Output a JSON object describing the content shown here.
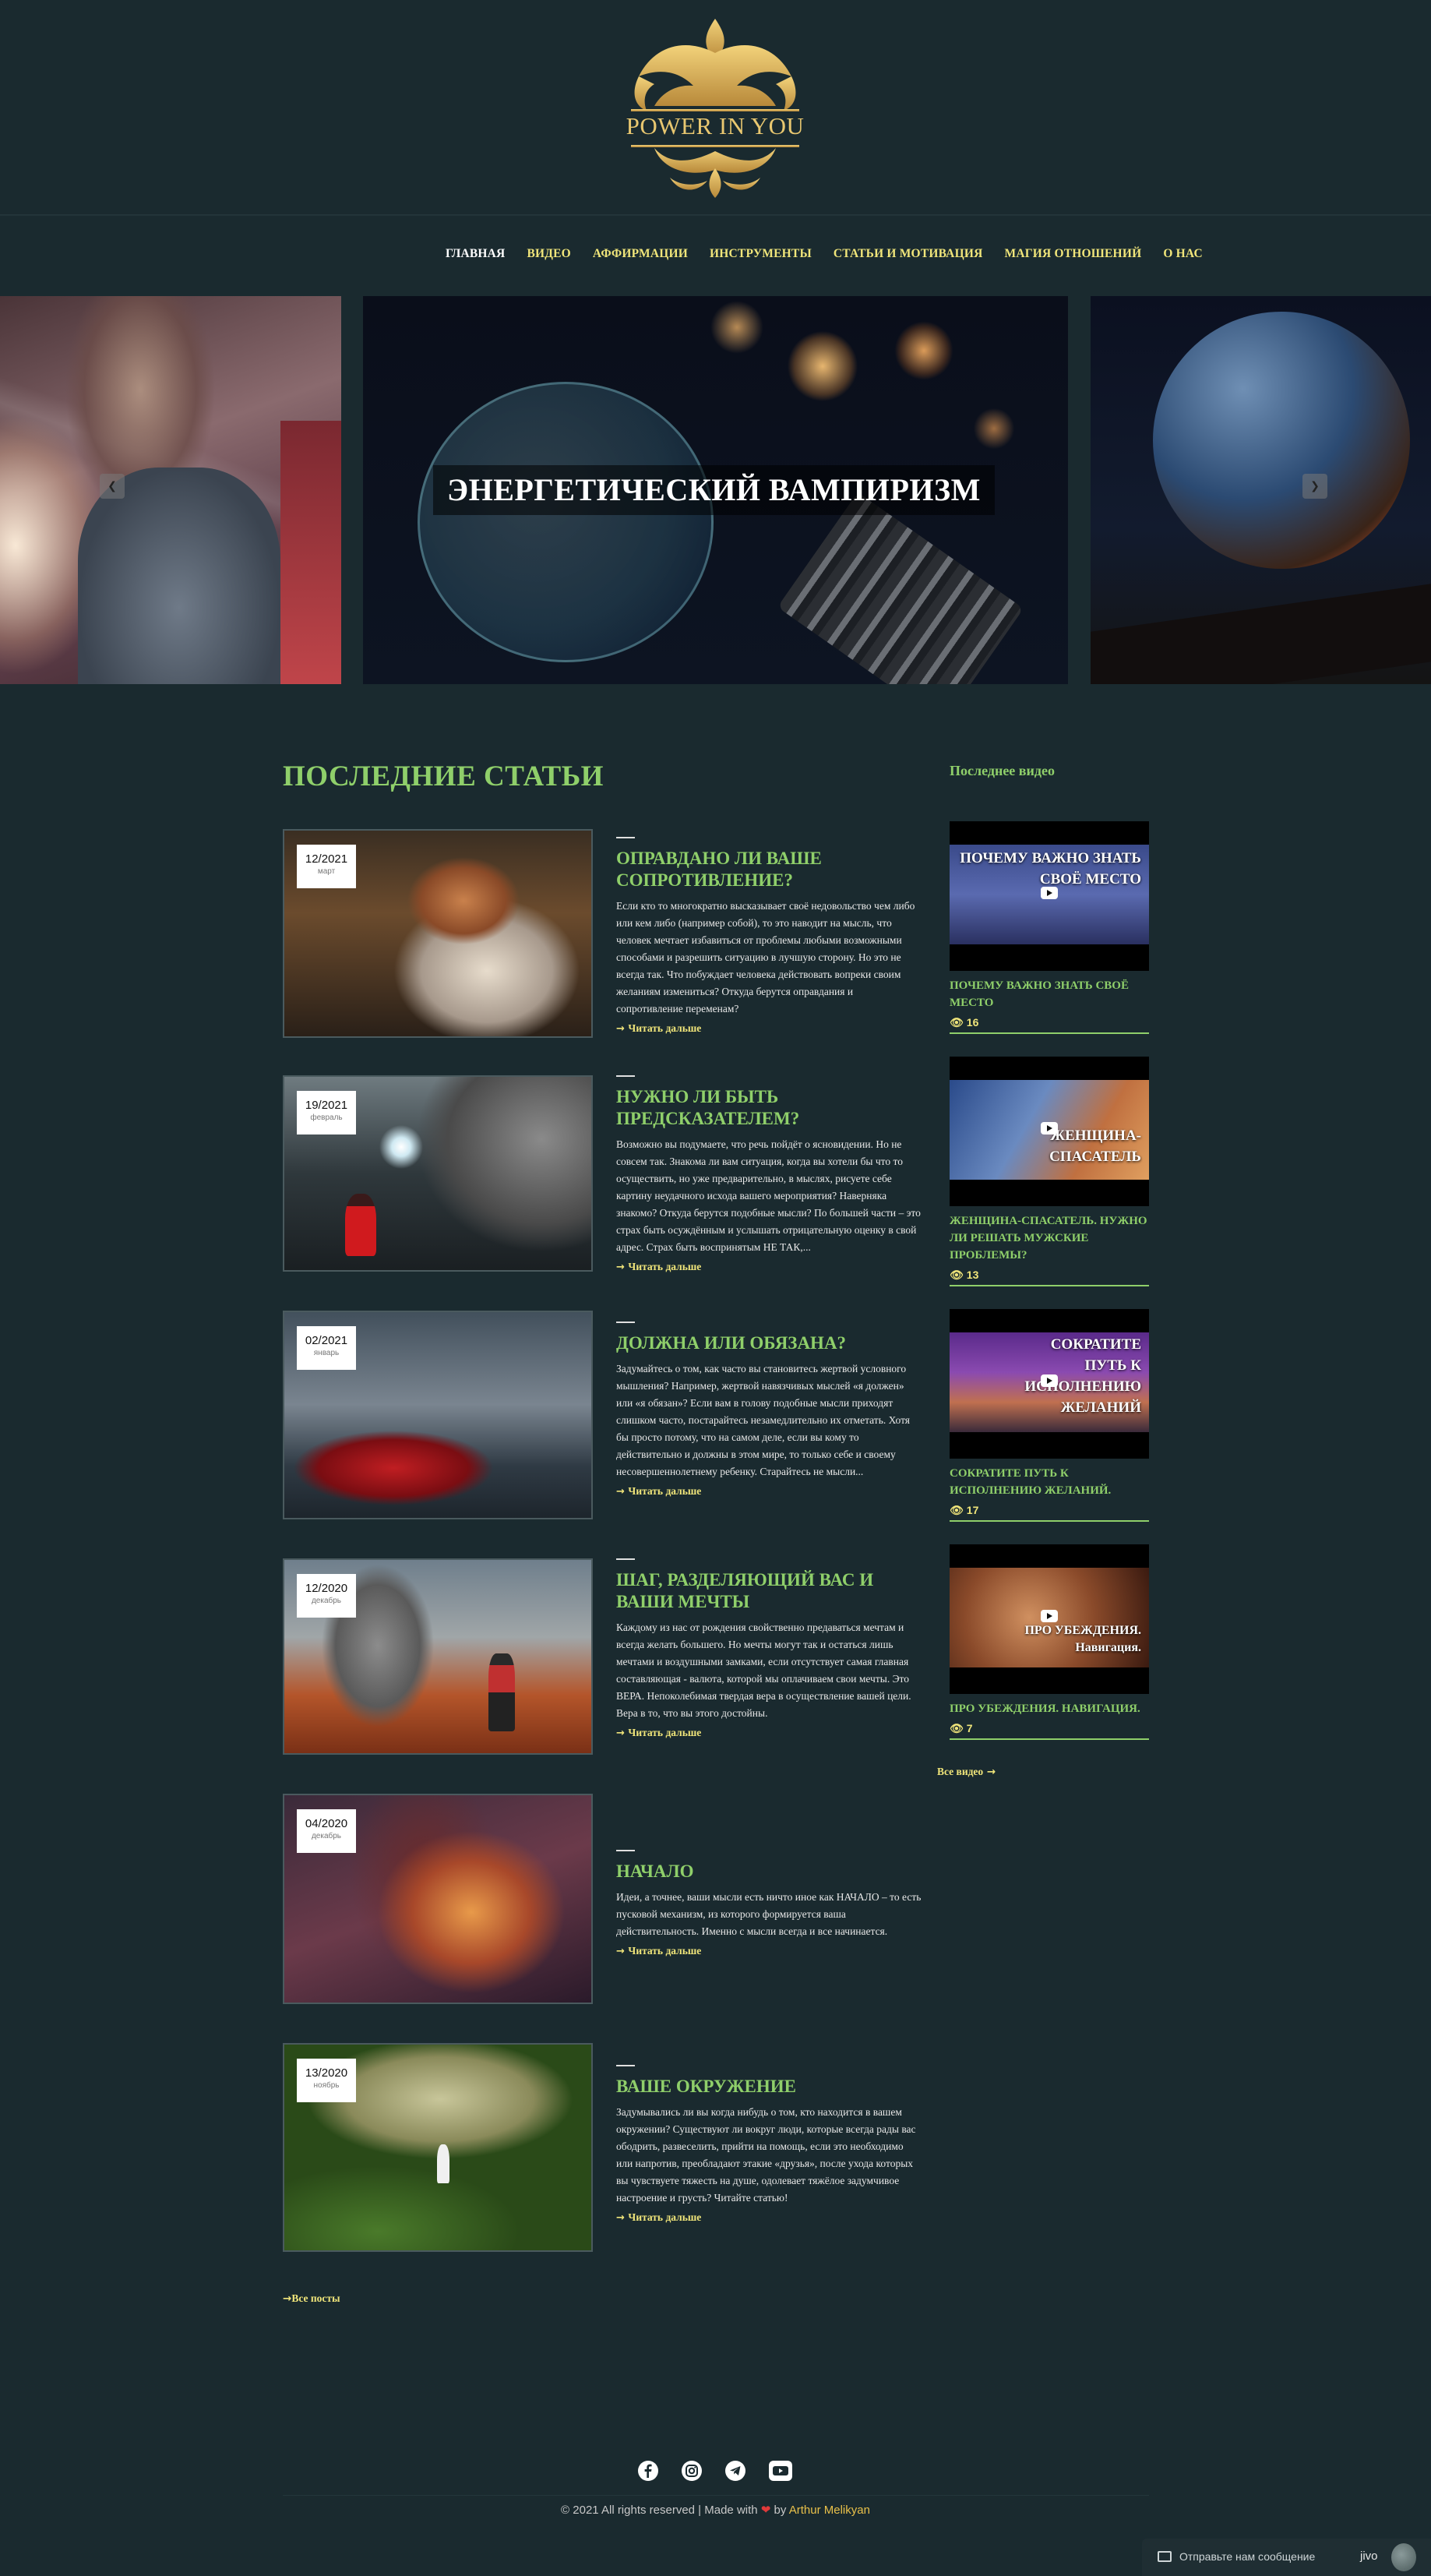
{
  "logo": {
    "text": "POWER IN YOU"
  },
  "nav": {
    "items": [
      "Главная",
      "Видео",
      "Аффирмации",
      "Инструменты",
      "Статьи и мотивация",
      "Магия отношений",
      "О нас"
    ]
  },
  "slider": {
    "caption": "Энергетический вампиризм",
    "prev_icon": "chevron-left-icon",
    "next_icon": "chevron-right-icon"
  },
  "articles_section": {
    "title": "ПОСЛЕДНИЕ СТАТЬИ",
    "read_more": "Читать дальше",
    "all_posts": "Все посты",
    "items": [
      {
        "date": "12/2021",
        "month": "март",
        "title": "Оправдано ли ваше сопротивление?",
        "text": "Если кто то многократно высказывает своё недовольство чем либо или кем либо (например собой), то это наводит на мысль, что человек мечтает избавиться от проблемы любыми возможными способами и разрешить ситуацию в лучшую сторону. Но это не всегда так. Что побуждает человека действовать вопреки своим желаниям измениться? Откуда берутся оправдания и сопротивление переменам?"
      },
      {
        "date": "19/2021",
        "month": "февраль",
        "title": "Нужно ли быть предсказателем?",
        "text": "Возможно вы подумаете, что речь пойдёт о ясновидении. Но не совсем так. Знакома ли вам ситуация, когда вы хотели бы что то осуществить, но уже предварительно, в мыслях, рисуете себе картину неудачного исхода вашего мероприятия? Наверняка знакомо? Откуда берутся подобные мысли? По большей части – это страх быть осуждённым и услышать отрицательную оценку в свой адрес. Страх быть воспринятым НЕ ТАК,..."
      },
      {
        "date": "02/2021",
        "month": "январь",
        "title": "Должна или обязана?",
        "text": "Задумайтесь о том, как часто вы становитесь жертвой условного мышления? Например, жертвой навязчивых мыслей «я должен» или «я обязан»? Если вам в голову подобные мысли приходят слишком часто, постарайтесь незамедлительно их отметать. Хотя бы просто потому, что на самом деле, если вы кому то действительно и должны в этом мире, то только себе и своему несовершеннолетнему ребенку. Старайтесь не мысли..."
      },
      {
        "date": "12/2020",
        "month": "декабрь",
        "title": "Шаг, разделяющий вас и ваши мечты",
        "text": "Каждому из нас от рождения свойственно предаваться мечтам и всегда желать большего. Но мечты могут так и остаться лишь мечтами и воздушными замками, если отсутствует самая главная составляющая - валюта, которой мы оплачиваем свои мечты. Это ВЕРА. Непоколебимая твердая вера в осуществление вашей цели. Вера в то, что вы этого достойны."
      },
      {
        "date": "04/2020",
        "month": "декабрь",
        "title": "Начало",
        "text": "Идеи, а точнее, ваши мысли есть ничто иное как НАЧАЛО – то есть пусковой механизм, из которого формируется ваша действительность. Именно с мысли всегда и все начинается."
      },
      {
        "date": "13/2020",
        "month": "ноябрь",
        "title": "Ваше окружение",
        "text": "Задумывались ли вы когда нибудь о том, кто находится в вашем окружении? Существуют ли вокруг люди, которые всегда рады вас ободрить, развеселить, прийти на помощь, если это необходимо или напротив, преобладают этакие «друзья», после ухода которых вы чувствуете тяжесть на душе, одолевает тяжёлое задумчивое настроение и грусть? Читайте статью!"
      }
    ]
  },
  "videos_section": {
    "title": "Последнее видео",
    "all_videos": "Все видео",
    "items": [
      {
        "thumb_text": "ПОЧЕМУ ВАЖНО ЗНАТЬ СВОЁ МЕСТО",
        "title": "Почему важно знать своё место",
        "views": "16"
      },
      {
        "thumb_text": "ЖЕНЩИНА-СПАСАТЕЛЬ",
        "title": "Женщина-спасатель. Нужно ли решать мужские проблемы?",
        "views": "13"
      },
      {
        "thumb_text": "СОКРАТИТЕ ПУТЬ К ИСПОЛНЕНИЮ ЖЕЛАНИЙ",
        "title": "Сократите путь к исполнению желаний.",
        "views": "17"
      },
      {
        "thumb_text": "ПРО УБЕЖДЕНИЯ. Навигация.",
        "title": "Про убеждения. Навигация.",
        "views": "7"
      }
    ]
  },
  "footer": {
    "social_icons": [
      "facebook-icon",
      "instagram-icon",
      "telegram-icon",
      "youtube-icon"
    ],
    "copyright_prefix": "© 2021 All rights reserved | Made with",
    "copyright_by": "by",
    "author": "Arthur Melikyan"
  },
  "chat_widget": {
    "message": "Отправьте нам сообщение",
    "brand": "jivo"
  },
  "colors": {
    "background": "#1a2a2f",
    "accent_green": "#8fcf6a",
    "accent_yellow": "#f0e57a",
    "logo_gold": "#d9b45a"
  }
}
